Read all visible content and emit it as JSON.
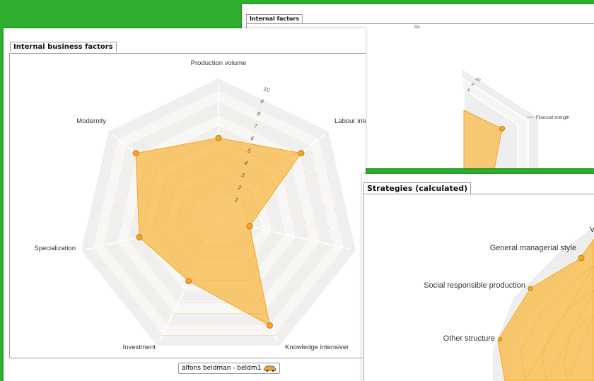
{
  "background_color": "#2fae2f",
  "back_panel": {
    "title": "Internal factors",
    "partial_top_label": "Dir.",
    "axis_label_right": "Financial strength",
    "tick_values": [
      "10",
      "9",
      "8"
    ]
  },
  "main_panel": {
    "title": "Internal business factors",
    "user_tag": "alfons beldman - beldm1",
    "user_icon": "car-icon"
  },
  "strategies_panel": {
    "title": "Strategies (calculated)",
    "labels": {
      "truncated": "V",
      "general_managerial_style": "General managerial style",
      "social_responsible_production": "Social responsible production",
      "other_structure": "Other structure"
    }
  },
  "chart_data": {
    "type": "radar",
    "title": "Internal business factors",
    "axes": [
      "Production volume",
      "Labour intensiveness",
      "Knowledge intensiveness",
      "Investment",
      "Specialization",
      "Modernity"
    ],
    "axis_display_labels": [
      "Production volume",
      "Labour intensiveness",
      "Knowledge intensiver",
      "Investment",
      "Specialization",
      "Modernity"
    ],
    "rlim": [
      0,
      10
    ],
    "ticks": [
      "1",
      "2",
      "3",
      "4",
      "5",
      "6",
      "7",
      "8",
      "9",
      "10"
    ],
    "values": [
      6,
      8,
      2,
      9,
      5,
      6,
      8
    ],
    "fill_color": "#f9bb4a",
    "point_color": "#f5a623"
  }
}
